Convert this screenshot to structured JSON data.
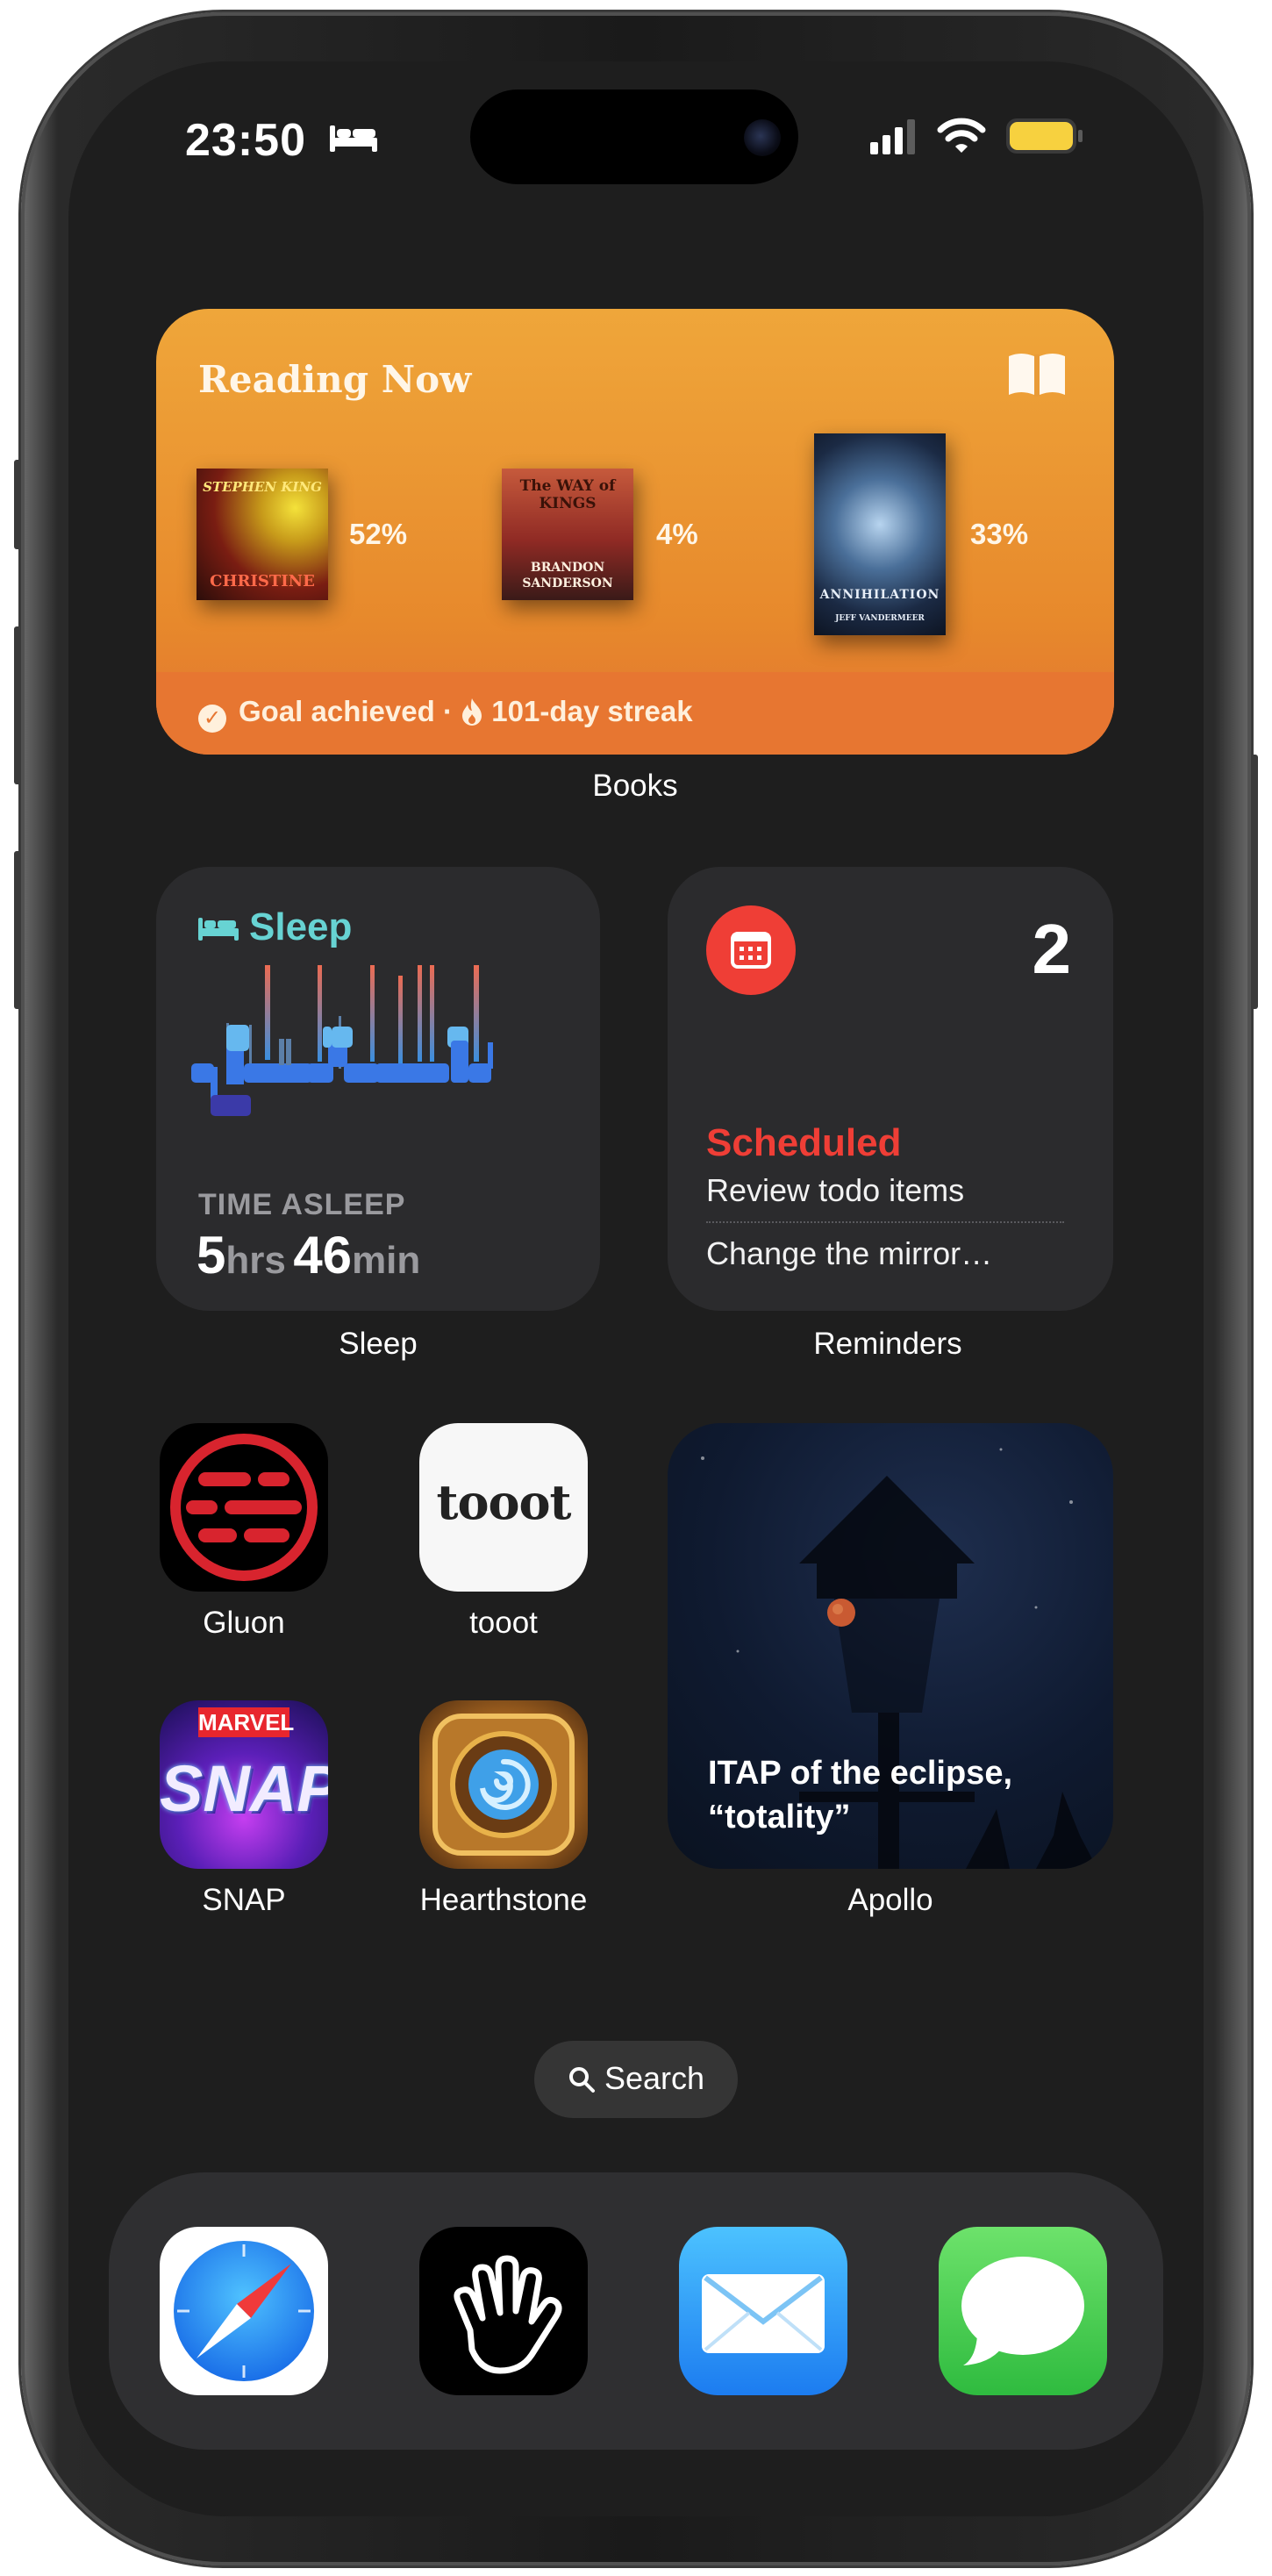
{
  "status_bar": {
    "time": "23:50",
    "sleep_mode_icon": "bed-icon",
    "battery_color": "#f7d13f"
  },
  "books_widget": {
    "title": "Reading Now",
    "books": [
      {
        "cover_title": "CHRISTINE",
        "cover_author": "STEPHEN KING",
        "progress": "52%"
      },
      {
        "cover_title": "The WAY of KINGS",
        "cover_author": "BRANDON SANDERSON",
        "progress": "4%"
      },
      {
        "cover_title": "ANNIHILATION",
        "cover_author": "JEFF VANDERMEER",
        "progress": "33%"
      }
    ],
    "goal_text": "Goal achieved",
    "streak_text": "101-day streak",
    "label": "Books"
  },
  "sleep_widget": {
    "title": "Sleep",
    "caption": "TIME ASLEEP",
    "hours": "5",
    "hours_unit": "hrs",
    "minutes": "46",
    "minutes_unit": "min",
    "label": "Sleep"
  },
  "reminders_widget": {
    "count": "2",
    "list_title": "Scheduled",
    "items": [
      "Review todo items",
      "Change the mirror…"
    ],
    "label": "Reminders",
    "accent": "#ef3e36"
  },
  "apps": [
    {
      "name": "Gluon"
    },
    {
      "name": "tooot",
      "icon_text": "tooot"
    },
    {
      "name": "SNAP",
      "icon_text_top": "MARVEL",
      "icon_text": "SNAP"
    },
    {
      "name": "Hearthstone"
    }
  ],
  "apollo_widget": {
    "caption_line1": "ITAP of the eclipse,",
    "caption_line2": "“totality”",
    "label": "Apollo"
  },
  "search": {
    "label": "Search"
  },
  "dock": [
    {
      "name": "Safari",
      "icon": "safari-compass-icon"
    },
    {
      "name": "Hand app",
      "icon": "hand-icon"
    },
    {
      "name": "Mail",
      "icon": "envelope-icon"
    },
    {
      "name": "Messages",
      "icon": "speech-bubble-icon"
    }
  ]
}
